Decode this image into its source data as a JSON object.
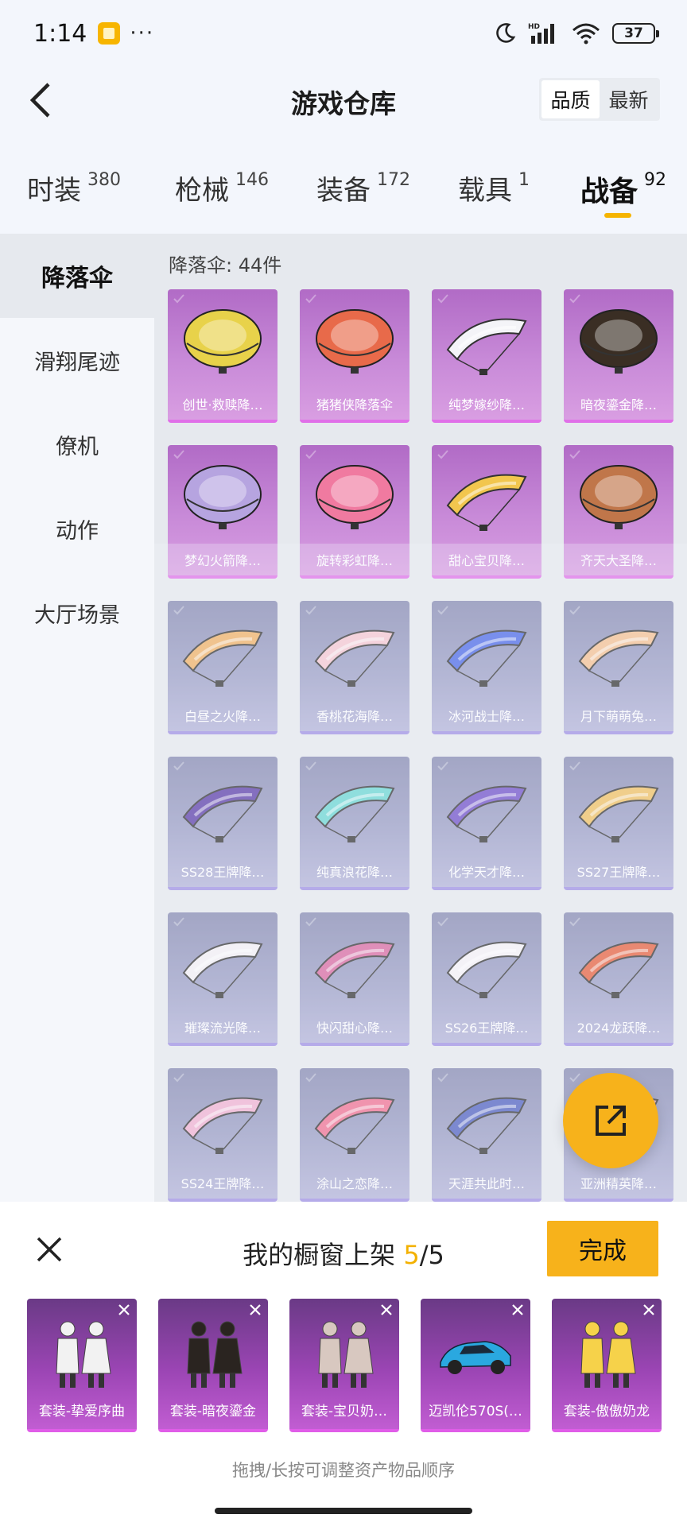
{
  "status_bar": {
    "time": "1:14",
    "dots": "···",
    "battery": "37"
  },
  "header": {
    "title": "游戏仓库",
    "sort": [
      "品质",
      "最新"
    ],
    "sort_active": 0
  },
  "tabs": [
    {
      "label": "时装",
      "count": "380"
    },
    {
      "label": "枪械",
      "count": "146"
    },
    {
      "label": "装备",
      "count": "172"
    },
    {
      "label": "载具",
      "count": "1"
    },
    {
      "label": "战备",
      "count": "92"
    }
  ],
  "active_tab": 4,
  "sidebar": {
    "items": [
      "降落伞",
      "滑翔尾迹",
      "僚机",
      "动作",
      "大厅场景"
    ],
    "active": 0
  },
  "main": {
    "count_label": "降落伞: 44件",
    "items": [
      {
        "name": "创世·救赎降…",
        "color": "#e8d24a",
        "tier": "purple"
      },
      {
        "name": "猪猪侠降落伞",
        "color": "#e86a4a",
        "tier": "purple"
      },
      {
        "name": "纯梦嫁纱降…",
        "color": "#f4f4f8",
        "tier": "purple"
      },
      {
        "name": "暗夜鎏金降…",
        "color": "#3a2e24",
        "tier": "purple"
      },
      {
        "name": "梦幻火箭降…",
        "color": "#b6a4e0",
        "tier": "purple"
      },
      {
        "name": "旋转彩虹降…",
        "color": "#f07aa0",
        "tier": "purple"
      },
      {
        "name": "甜心宝贝降…",
        "color": "#f2c64e",
        "tier": "purple"
      },
      {
        "name": "齐天大圣降…",
        "color": "#c0764a",
        "tier": "purple"
      },
      {
        "name": "白昼之火降…",
        "color": "#f0b064",
        "tier": "blue"
      },
      {
        "name": "香桃花海降…",
        "color": "#f5c6d0",
        "tier": "blue"
      },
      {
        "name": "冰河战士降…",
        "color": "#4c68e6",
        "tier": "blue"
      },
      {
        "name": "月下萌萌兔…",
        "color": "#f4c090",
        "tier": "blue"
      },
      {
        "name": "SS28王牌降…",
        "color": "#5a3ca8",
        "tier": "blue"
      },
      {
        "name": "纯真浪花降…",
        "color": "#6ad6d2",
        "tier": "blue"
      },
      {
        "name": "化学天才降…",
        "color": "#7050c8",
        "tier": "blue"
      },
      {
        "name": "SS27王牌降…",
        "color": "#f0c060",
        "tier": "blue"
      },
      {
        "name": "璀璨流光降…",
        "color": "#f4f0f4",
        "tier": "blue"
      },
      {
        "name": "快闪甜心降…",
        "color": "#d868a0",
        "tier": "blue"
      },
      {
        "name": "SS26王牌降…",
        "color": "#f6f2f6",
        "tier": "blue"
      },
      {
        "name": "2024龙跃降…",
        "color": "#e6603e",
        "tier": "blue"
      },
      {
        "name": "SS24王牌降…",
        "color": "#f0b0d0",
        "tier": "blue"
      },
      {
        "name": "涂山之恋降…",
        "color": "#f07090",
        "tier": "blue"
      },
      {
        "name": "天涯共此时…",
        "color": "#5060c0",
        "tier": "blue"
      },
      {
        "name": "亚洲精英降…",
        "color": "#e0a0a8",
        "tier": "blue"
      }
    ]
  },
  "sheet": {
    "title": "我的橱窗上架",
    "count": "5",
    "total": "/5",
    "done_label": "完成",
    "hint": "拖拽/长按可调整资产物品顺序",
    "items": [
      {
        "name": "套装-挚爱序曲",
        "icon": "outfit-couple-white-icon",
        "color": "#f2f2f2"
      },
      {
        "name": "套装-暗夜鎏金",
        "icon": "outfit-couple-dark-icon",
        "color": "#2a2420"
      },
      {
        "name": "套装-宝贝奶…",
        "icon": "outfit-couple-cream-icon",
        "color": "#d8c8c0"
      },
      {
        "name": "迈凯伦570S(…",
        "icon": "car-icon",
        "color": "#2aa8e0"
      },
      {
        "name": "套装-傲傲奶龙",
        "icon": "outfit-yellow-dragon-icon",
        "color": "#f6d24a"
      }
    ]
  }
}
